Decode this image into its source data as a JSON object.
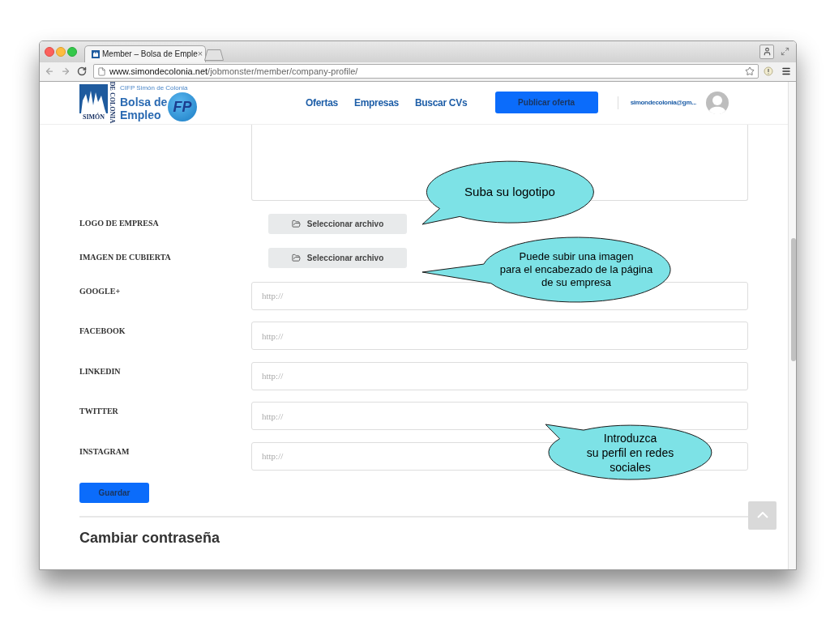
{
  "browser": {
    "tab": {
      "title": "Member – Bolsa de Emple",
      "close": "×"
    },
    "address_bar": {
      "domain": "www.simondecolonia.net",
      "path": "/jobmonster/member/company-profile/"
    }
  },
  "header": {
    "logo": {
      "emblem_text": "SIMÓN",
      "side_text": "DE COLONIA",
      "subtitle": "CIFP Simón de Colonia",
      "title": "Bolsa de Empleo",
      "badge": "FP"
    },
    "nav": [
      {
        "label": "Ofertas"
      },
      {
        "label": "Empresas"
      },
      {
        "label": "Buscar CVs"
      }
    ],
    "post_button": "Publicar oferta",
    "user_email": "simondecolonia@gm..."
  },
  "form": {
    "file_fields": [
      {
        "label": "LOGO DE EMPRESA",
        "button": "Seleccionar archivo"
      },
      {
        "label": "IMAGEN DE CUBIERTA",
        "button": "Seleccionar archivo"
      }
    ],
    "url_fields": [
      {
        "label": "GOOGLE+",
        "placeholder": "http://"
      },
      {
        "label": "FACEBOOK",
        "placeholder": "http://"
      },
      {
        "label": "LINKEDIN",
        "placeholder": "http://"
      },
      {
        "label": "TWITTER",
        "placeholder": "http://"
      },
      {
        "label": "INSTAGRAM",
        "placeholder": "http://"
      }
    ],
    "save_button": "Guardar"
  },
  "password_section": {
    "title": "Cambiar contraseña"
  },
  "callouts": [
    {
      "text": "Suba su logotipo"
    },
    {
      "text": "Puede subir una imagen\npara el encabezado de la página\nde su empresa"
    },
    {
      "text": "Introduzca\nsu perfil en redes\nsociales"
    }
  ]
}
